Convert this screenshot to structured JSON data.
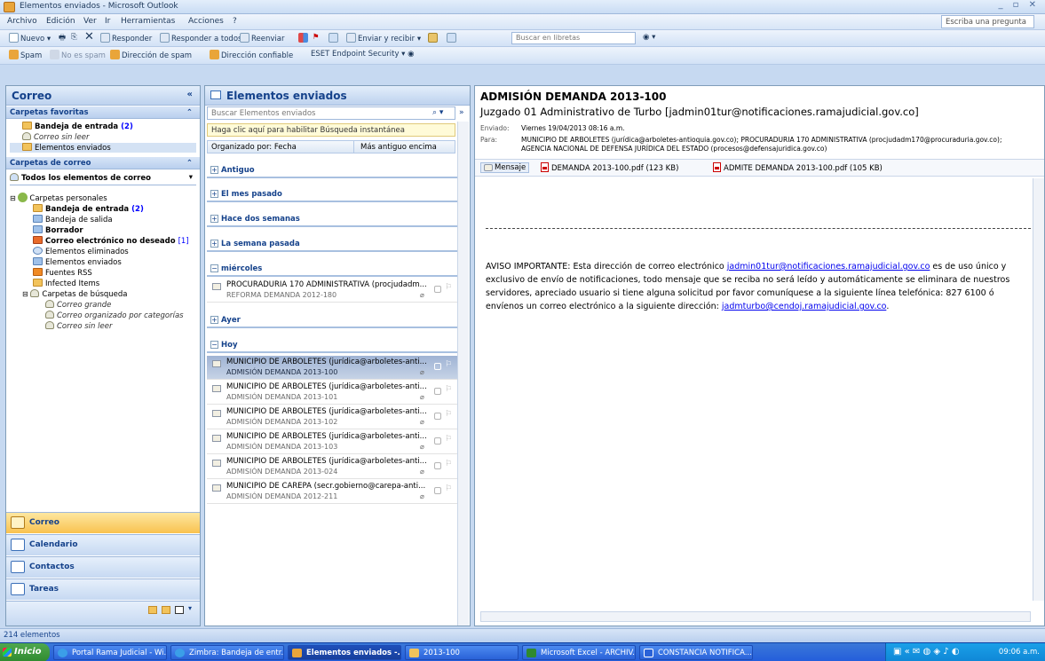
{
  "window": {
    "title": "Elementos enviados - Microsoft Outlook"
  },
  "menu": {
    "items": [
      "Archivo",
      "Edición",
      "Ver",
      "Ir",
      "Herramientas",
      "Acciones",
      "?"
    ],
    "ask_placeholder": "Escriba una pregunta"
  },
  "toolbar1": {
    "new": "Nuevo",
    "reply": "Responder",
    "reply_all": "Responder a todos",
    "forward": "Reenviar",
    "send_receive": "Enviar y recibir",
    "search_books": "Buscar en libretas"
  },
  "toolbar2": {
    "spam": "Spam",
    "not_spam": "No es spam",
    "spam_address": "Dirección de spam",
    "trusted_address": "Dirección confiable",
    "eset": "ESET Endpoint Security"
  },
  "nav": {
    "title": "Correo",
    "favorites_header": "Carpetas favoritas",
    "favorites": [
      {
        "label": "Bandeja de entrada",
        "count": "(2)"
      },
      {
        "label": "Correo sin leer"
      },
      {
        "label": "Elementos enviados"
      }
    ],
    "mail_folders_header": "Carpetas de correo",
    "all_items": "Todos los elementos de correo",
    "root": "Carpetas personales",
    "folders": [
      {
        "label": "Bandeja de entrada",
        "count": "(2)"
      },
      {
        "label": "Bandeja de salida"
      },
      {
        "label": "Borrador"
      },
      {
        "label": "Correo electrónico no deseado",
        "count": "[1]"
      },
      {
        "label": "Elementos eliminados"
      },
      {
        "label": "Elementos enviados"
      },
      {
        "label": "Fuentes RSS"
      },
      {
        "label": "Infected Items"
      },
      {
        "label": "Carpetas de búsqueda"
      }
    ],
    "search_folders": [
      "Correo grande",
      "Correo organizado por categorías",
      "Correo sin leer"
    ],
    "buttons": [
      "Correo",
      "Calendario",
      "Contactos",
      "Tareas"
    ]
  },
  "list": {
    "title": "Elementos enviados",
    "search_placeholder": "Buscar Elementos enviados",
    "hint": "Haga clic aquí para habilitar Búsqueda instantánea",
    "sort_by": "Organizado por: Fecha",
    "sort_order": "Más antiguo encima",
    "groups": [
      "Antiguo",
      "El mes pasado",
      "Hace dos semanas",
      "La semana pasada",
      "miércoles",
      "Ayer",
      "Hoy"
    ],
    "wednesday_msg": {
      "from": "PROCURADURIA 170 ADMINISTRATIVA (procjudadm...",
      "subject": "REFORMA DEMANDA 2012-180"
    },
    "today_msgs": [
      {
        "from": "MUNICIPIO DE ARBOLETES (jurídica@arboletes-anti...",
        "subject": "ADMISIÓN DEMANDA 2013-100"
      },
      {
        "from": "MUNICIPIO DE ARBOLETES (jurídica@arboletes-anti...",
        "subject": "ADMISIÓN DEMANDA 2013-101"
      },
      {
        "from": "MUNICIPIO DE ARBOLETES (jurídica@arboletes-anti...",
        "subject": "ADMISIÓN DEMANDA 2013-102"
      },
      {
        "from": "MUNICIPIO DE ARBOLETES (jurídica@arboletes-anti...",
        "subject": "ADMISIÓN DEMANDA 2013-103"
      },
      {
        "from": "MUNICIPIO DE ARBOLETES (jurídica@arboletes-anti...",
        "subject": "ADMISIÓN DEMANDA 2013-024"
      },
      {
        "from": "MUNICIPIO DE CAREPA (secr.gobierno@carepa-anti...",
        "subject": "ADMISIÓN DEMANDA 2012-211"
      }
    ]
  },
  "reading": {
    "subject": "ADMISIÓN DEMANDA 2013-100",
    "from": "Juzgado 01 Administrativo de Turbo [jadmin01tur@notificaciones.ramajudicial.gov.co]",
    "sent_label": "Enviado:",
    "sent_value": "Viernes 19/04/2013 08:16 a.m.",
    "to_label": "Para:",
    "to_line1": "MUNICIPIO DE ARBOLETES (jurídica@arboletes-antioquia.gov.co); PROCURADURIA 170 ADMINISTRATIVA (procjudadm170@procuraduria.gov.co);",
    "to_line2": "AGENCIA NACIONAL DE DEFENSA JURÍDICA DEL ESTADO (procesos@defensajuridica.gov.co)",
    "attachments": [
      "Mensaje",
      "DEMANDA 2013-100.pdf (123 KB)",
      "ADMITE DEMANDA 2013-100.pdf (105 KB)"
    ],
    "body_p1": "AVISO IMPORTANTE: Esta dirección de correo electrónico ",
    "body_link1": "jadmin01tur@notificaciones.ramajudicial.gov.co",
    "body_p2": " es de uso único y exclusivo de envío de notificaciones, todo mensaje que se reciba no será leído y automáticamente se eliminara de nuestros servidores, apreciado usuario si tiene alguna solicitud por favor comuníquese a la siguiente línea telefónica: 827 6100 ó envíenos un correo electrónico a la siguiente dirección: ",
    "body_link2": "jadmturbo@cendoj.ramajudicial.gov.co",
    "body_end": "."
  },
  "status": {
    "count": "214 elementos"
  },
  "taskbar": {
    "start": "Inicio",
    "tasks": [
      "Portal Rama Judicial - Wi...",
      "Zimbra: Bandeja de entr...",
      "Elementos enviados -...",
      "2013-100",
      "Microsoft Excel - ARCHIV...",
      "CONSTANCIA NOTIFICA..."
    ],
    "clock": "09:06 a.m."
  },
  "colors": {
    "accent": "#15428b",
    "selected_row": "#9fb3d4",
    "active_nav": "#f9c24f"
  }
}
